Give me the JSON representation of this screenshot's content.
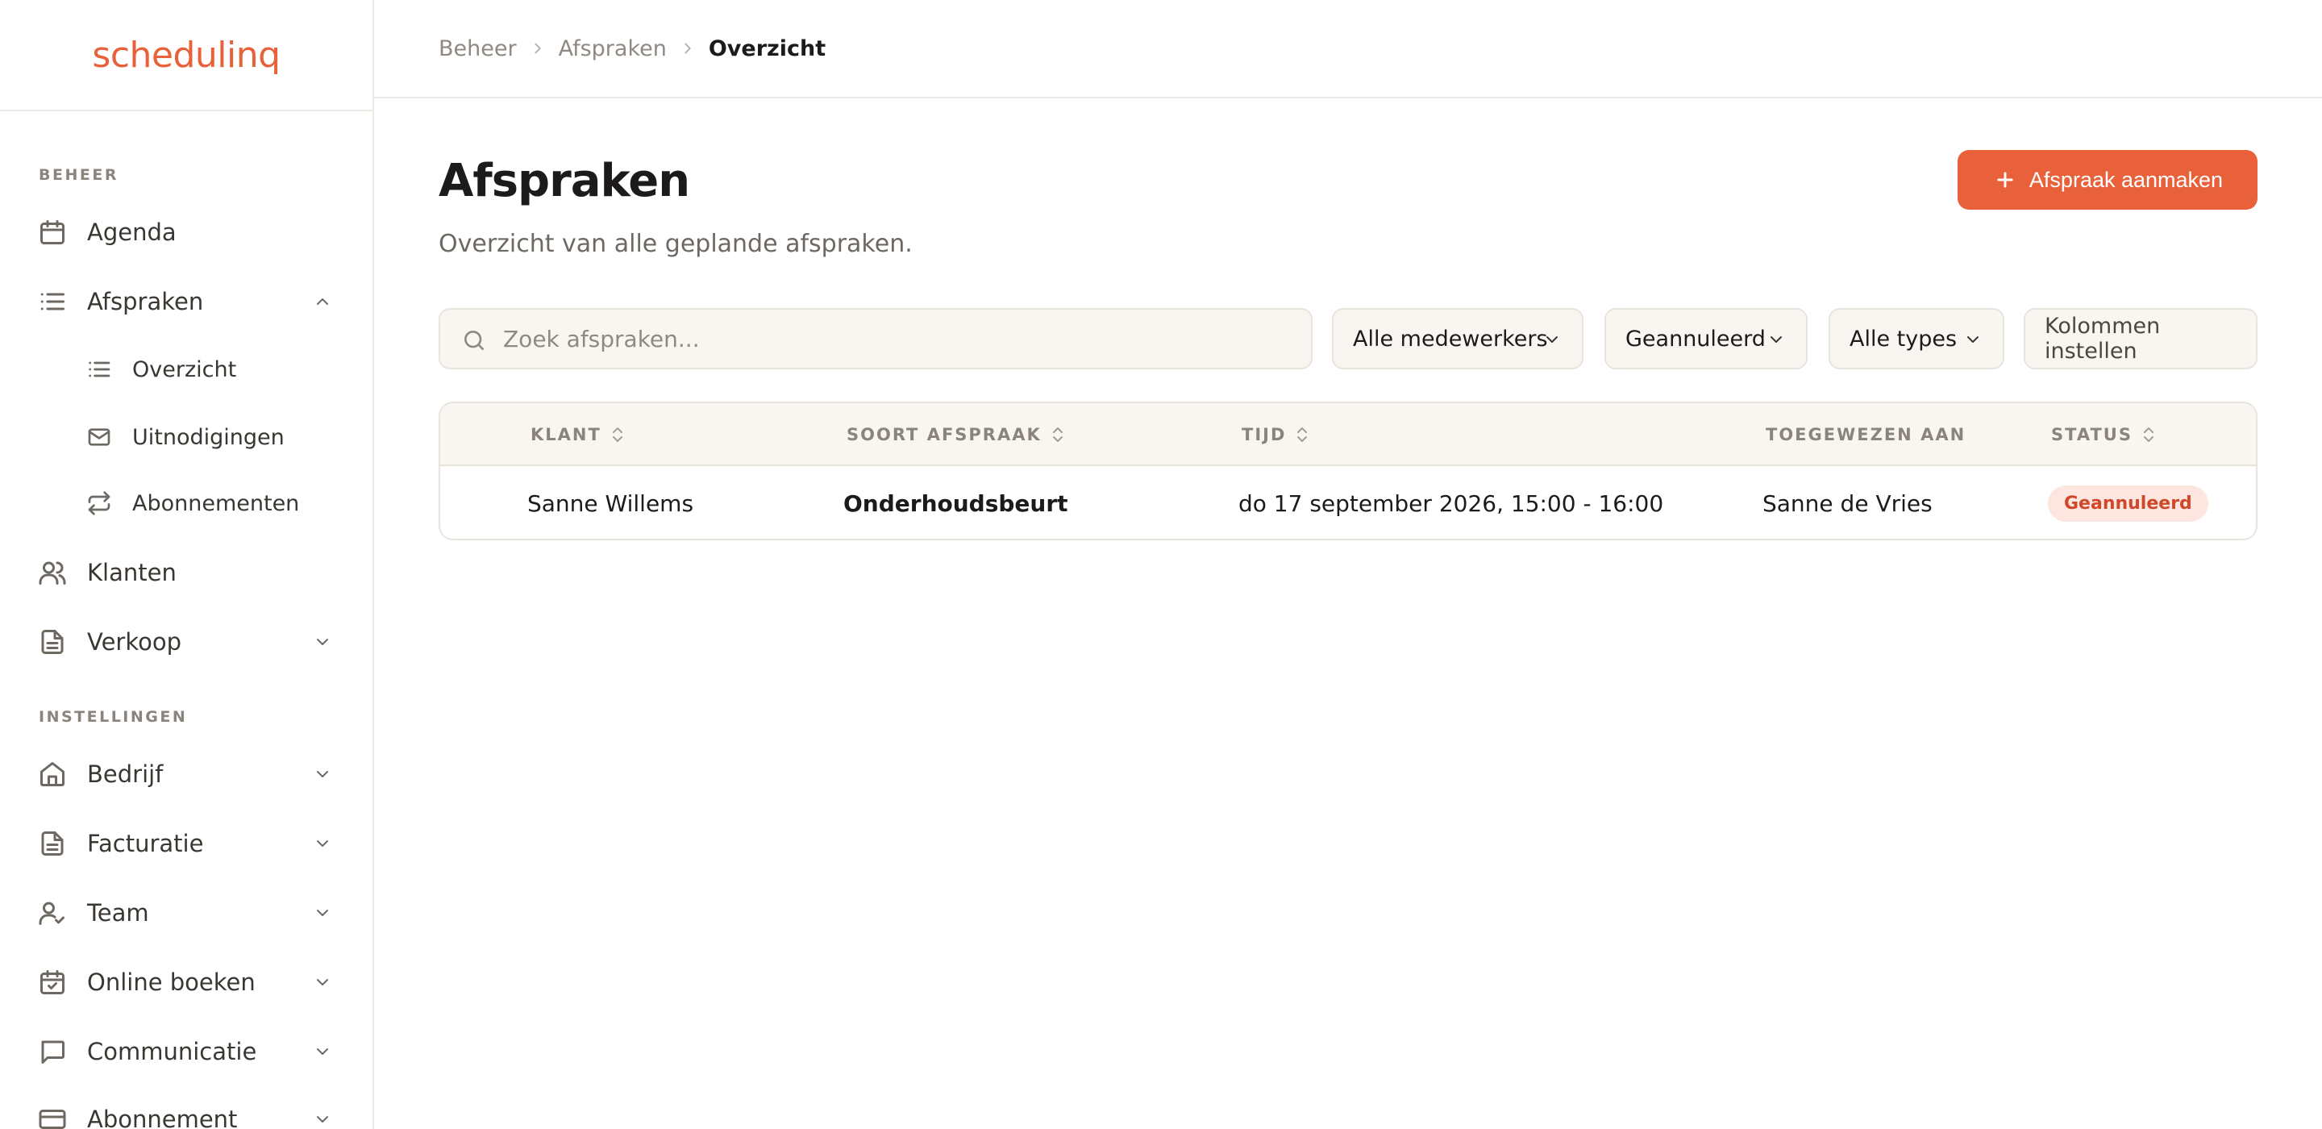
{
  "app": {
    "logo": "schedulinq",
    "accent": "#e8613a"
  },
  "sidebar": {
    "section_beheer": "BEHEER",
    "section_instellingen": "INSTELLINGEN",
    "items": [
      {
        "label": "Agenda",
        "icon": "calendar-icon"
      },
      {
        "label": "Afspraken",
        "icon": "list-icon",
        "expanded": true
      },
      {
        "label": "Klanten",
        "icon": "users-icon"
      },
      {
        "label": "Verkoop",
        "icon": "document-icon"
      },
      {
        "label": "Bedrijf",
        "icon": "home-icon"
      },
      {
        "label": "Facturatie",
        "icon": "document-icon"
      },
      {
        "label": "Team",
        "icon": "user-check-icon"
      },
      {
        "label": "Online boeken",
        "icon": "calendar-check-icon"
      },
      {
        "label": "Communicatie",
        "icon": "chat-icon"
      },
      {
        "label": "Abonnement",
        "icon": "credit-card-icon"
      }
    ],
    "subitems": [
      {
        "label": "Overzicht",
        "icon": "list-icon"
      },
      {
        "label": "Uitnodigingen",
        "icon": "mail-icon"
      },
      {
        "label": "Abonnementen",
        "icon": "repeat-icon"
      }
    ]
  },
  "breadcrumb": [
    "Beheer",
    "Afspraken",
    "Overzicht"
  ],
  "page": {
    "title": "Afspraken",
    "subtitle": "Overzicht van alle geplande afspraken.",
    "create_button": "Afspraak aanmaken"
  },
  "filters": {
    "search_placeholder": "Zoek afspraken...",
    "employees": "Alle medewerkers",
    "status": "Geannuleerd",
    "types": "Alle types",
    "columns": "Kolommen instellen"
  },
  "table": {
    "columns": [
      "KLANT",
      "SOORT AFSPRAAK",
      "TIJD",
      "TOEGEWEZEN AAN",
      "STATUS"
    ],
    "rows": [
      {
        "client": "Sanne Willems",
        "type": "Onderhoudsbeurt",
        "time": "do 17 september 2026, 15:00 - 16:00",
        "assigned": "Sanne de Vries",
        "status": "Geannuleerd"
      }
    ]
  }
}
